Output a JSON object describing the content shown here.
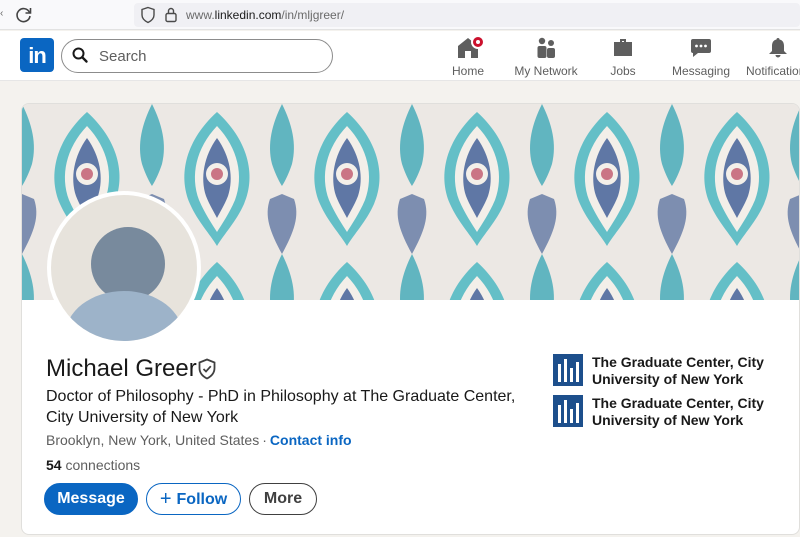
{
  "browser": {
    "url_prefix": "www.",
    "url_domain": "linkedin.com",
    "url_path": "/in/mljgreer/"
  },
  "nav": {
    "search_placeholder": "Search",
    "items": [
      {
        "label": "Home",
        "icon": "home-icon"
      },
      {
        "label": "My Network",
        "icon": "network-icon"
      },
      {
        "label": "Jobs",
        "icon": "briefcase-icon"
      },
      {
        "label": "Messaging",
        "icon": "chat-icon"
      },
      {
        "label": "Notifications",
        "icon": "bell-icon"
      }
    ]
  },
  "profile": {
    "name": "Michael Greer",
    "headline": "Doctor of Philosophy - PhD in Philosophy at The Graduate Center, City University of New York",
    "location": "Brooklyn, New York, United States",
    "contact_link": "Contact info",
    "connections_count": "54",
    "connections_label": "connections",
    "buttons": {
      "message": "Message",
      "follow": "Follow",
      "more": "More"
    },
    "education": [
      {
        "name": "The Graduate Center, City University of New York"
      },
      {
        "name": "The Graduate Center, City University of New York"
      }
    ]
  },
  "colors": {
    "brand": "#0a66c2",
    "notification": "#cb112d",
    "school_logo": "#1d4f8c"
  }
}
